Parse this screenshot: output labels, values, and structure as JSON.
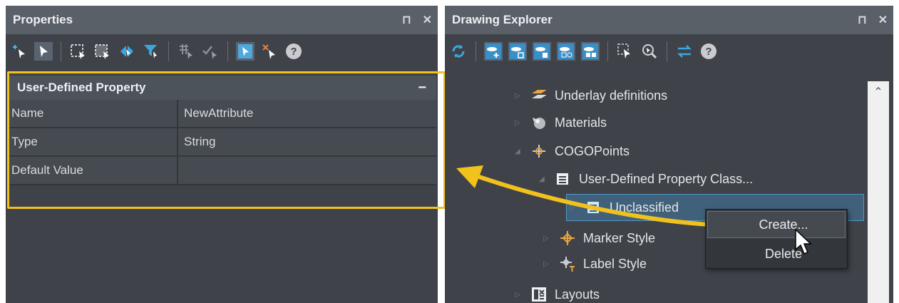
{
  "properties_panel": {
    "title": "Properties",
    "pin_glyph": "⊓",
    "close_glyph": "✕",
    "toolbar_icons": [
      "add-select-icon",
      "select-arrow-icon",
      "window-select-icon",
      "crossing-select-icon",
      "swap-selection-icon",
      "filter-icon",
      "grid-select-icon",
      "check-select-icon",
      "pick-object-icon",
      "deselect-icon",
      "help-icon"
    ],
    "help_label": "?",
    "section": {
      "title": "User-Defined Property",
      "collapse_glyph": "−",
      "rows": [
        {
          "name": "Name",
          "value": "NewAttribute"
        },
        {
          "name": "Type",
          "value": "String"
        },
        {
          "name": "Default Value",
          "value": ""
        }
      ]
    }
  },
  "explorer_panel": {
    "title": "Drawing Explorer",
    "pin_glyph": "⊓",
    "close_glyph": "✕",
    "toolbar_icons": [
      "refresh-icon",
      "add-view-icon",
      "view-square-icon",
      "view-fill-icon",
      "view-multi-icon",
      "view-split-icon",
      "select-objects-icon",
      "zoom-icon",
      "swap-icon",
      "help-icon"
    ],
    "help_label": "?",
    "tree": [
      {
        "label": "Underlay definitions",
        "icon": "underlay-icon"
      },
      {
        "label": "Materials",
        "icon": "materials-icon"
      },
      {
        "label": "COGOPoints",
        "icon": "cogo-point-icon"
      },
      {
        "label": "User-Defined Property Class...",
        "icon": "property-class-icon"
      },
      {
        "label": "Unclassified",
        "icon": "property-class-icon"
      },
      {
        "label": "Marker Style",
        "icon": "marker-style-icon"
      },
      {
        "label": "Label Style",
        "icon": "label-style-icon"
      },
      {
        "label": "Layouts",
        "icon": "layouts-icon"
      }
    ],
    "context_menu": {
      "items": [
        "Create...",
        "Delete"
      ]
    }
  },
  "colors": {
    "highlight": "#f2c21c",
    "panel_bg": "#3f4349",
    "title_bg": "#5a6068",
    "selected_row": "#41617a"
  }
}
